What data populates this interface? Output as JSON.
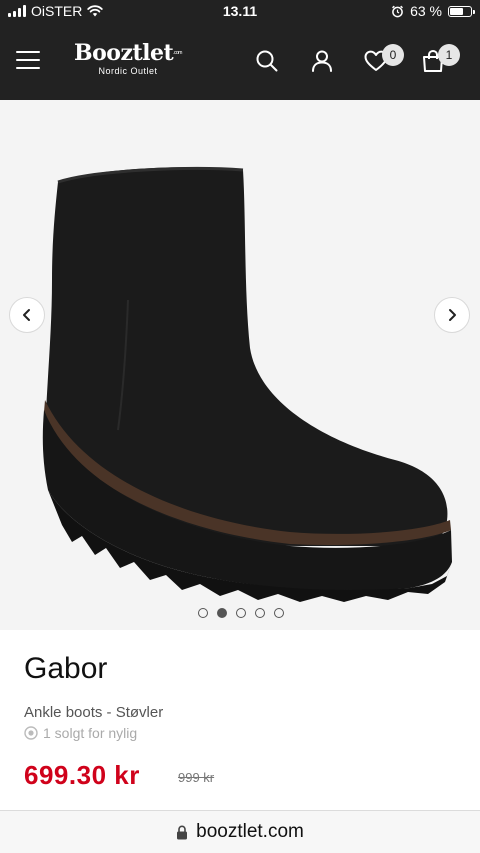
{
  "status_bar": {
    "carrier": "OiSTER",
    "time": "13.11",
    "battery_percent": "63 %",
    "battery_level": 0.63
  },
  "header": {
    "logo_text": "Booztlet",
    "logo_sub": "Nordic Outlet",
    "logo_com": ".com",
    "wishlist_count": "0",
    "cart_count": "1",
    "icons": [
      "menu-icon",
      "search-icon",
      "user-icon",
      "heart-icon",
      "bag-icon"
    ]
  },
  "gallery": {
    "image_count": 5,
    "active_index": 1
  },
  "product": {
    "brand": "Gabor",
    "category": "Ankle boots - Støvler",
    "sold_text": "1 solgt for nylig",
    "price": "699.30 kr",
    "old_price": "999 kr"
  },
  "browser": {
    "url": "booztlet.com"
  },
  "colors": {
    "header_bg": "#222222",
    "price_red": "#d0021b"
  }
}
